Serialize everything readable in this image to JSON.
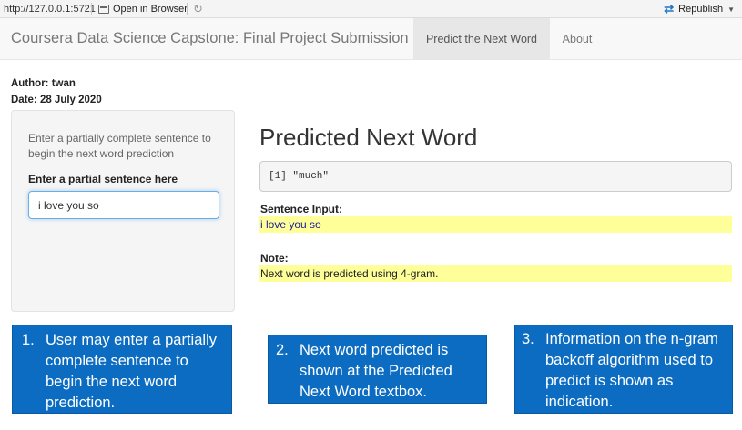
{
  "toolbar": {
    "url": "http://127.0.0.1:5721",
    "open_in_browser": "Open in Browser",
    "republish": "Republish",
    "icons": {
      "open": "window-icon",
      "refresh": "refresh-icon",
      "republish": "republish-icon",
      "caret": "caret-down-icon"
    }
  },
  "navbar": {
    "brand": "Coursera Data Science Capstone: Final Project Submission",
    "tabs": [
      {
        "label": "Predict the Next Word",
        "active": true
      },
      {
        "label": "About",
        "active": false
      }
    ]
  },
  "meta": {
    "author": "Author: twan",
    "date": "Date: 28 July 2020"
  },
  "sidebar": {
    "help_text": "Enter a partially complete sentence to begin the next word prediction",
    "input_label": "Enter a partial sentence here",
    "input_value": "i love you so"
  },
  "main": {
    "title": "Predicted Next Word",
    "prediction_output": "[1] \"much\"",
    "sentence_label": "Sentence Input:",
    "sentence_value": "i love you so",
    "note_label": "Note:",
    "note_value": "Next word is predicted using 4-gram."
  },
  "callouts": [
    {
      "number": "1.",
      "text": "User may enter a partially complete sentence to begin the next word prediction."
    },
    {
      "number": "2.",
      "text": "Next word predicted is shown at the Predicted Next Word textbox."
    },
    {
      "number": "3.",
      "text": "Information on the n-gram backoff algorithm used to predict is shown as indication."
    }
  ],
  "colors": {
    "callout_bg": "#0b6cc1",
    "highlight_bg": "#ffff99",
    "focus_border": "#66afe9"
  }
}
